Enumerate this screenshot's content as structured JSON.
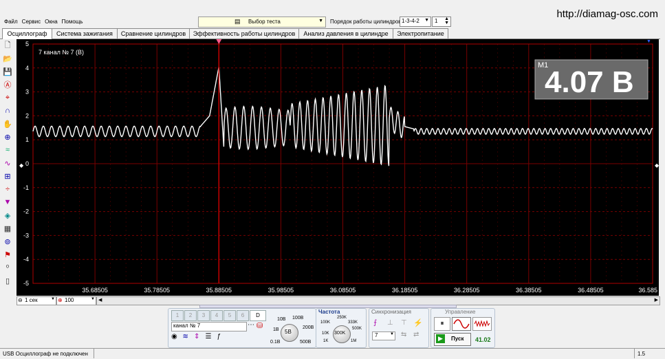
{
  "menu": [
    "Файл",
    "Сервис",
    "Окна",
    "Помощь"
  ],
  "site_url": "http://diamag-osc.com",
  "test_select": {
    "label": "Выбор теста"
  },
  "cylinder_order": {
    "label": "Порядок работы цилиндров",
    "value": "1-3-4-2",
    "stepper": "1"
  },
  "tabs": [
    {
      "label": "Осциллограф",
      "active": true
    },
    {
      "label": "Система зажигания",
      "active": false
    },
    {
      "label": "Сравнение цилиндров",
      "active": false
    },
    {
      "label": "Эффективность работы цилиндров",
      "active": false
    },
    {
      "label": "Анализ давления в цилиндре",
      "active": false
    },
    {
      "label": "Электропитание",
      "active": false
    }
  ],
  "toolbar_icons": [
    "new-file-icon",
    "open-folder-icon",
    "save-icon",
    "auto-icon",
    "cursor-icon",
    "headphones-icon",
    "hand-icon",
    "zoom-icon",
    "waves-icon",
    "wave-sync-icon",
    "measure-icon",
    "center-line-icon",
    "filter-icon",
    "layers-icon",
    "grid-icon",
    "reference-icon",
    "flag-icon",
    "zero-icon",
    "note-icon"
  ],
  "scope": {
    "channel_label": "7  канал № 7 (В)",
    "marker_label": "M1",
    "marker_value": "4.07 В",
    "waveform_color": "#ffffff",
    "grid_color": "#7a0000",
    "cursor_color": "#d00000"
  },
  "chart_data": {
    "type": "line",
    "y_ticks": [
      "5",
      "4",
      "3",
      "2",
      "1",
      "0",
      "-1",
      "-2",
      "-3",
      "-4",
      "-5"
    ],
    "x_ticks": [
      "35.68505",
      "35.78505",
      "35.88505",
      "35.98505",
      "36.08505",
      "36.18505",
      "36.28505",
      "36.38505",
      "36.48505",
      "36.585"
    ],
    "ylim": [
      -5,
      5
    ],
    "xlim": [
      35.585,
      36.585
    ],
    "cursor_x": 35.885,
    "marker_y": 4.07
  },
  "bottom_controls": {
    "time_scale": "1 сек",
    "count": "100"
  },
  "channel_panel": {
    "channel_buttons": [
      "1",
      "2",
      "3",
      "4",
      "5",
      "6"
    ],
    "d_button": "D",
    "channel_name": "канал № 7",
    "range_labels": [
      "10B",
      "100B",
      "1B",
      "200B",
      "0.1B",
      "500B"
    ],
    "range_value": "5B"
  },
  "frequency_panel": {
    "title": "Частота",
    "labels": [
      "250K",
      "100K",
      "333K",
      "10K",
      "500K",
      "1K",
      "1M"
    ],
    "value": "300K"
  },
  "sync_panel": {
    "title": "Синхронизация",
    "value": "7"
  },
  "control_panel": {
    "title": "Управление",
    "start_label": "Пуск",
    "fps": "41.02"
  },
  "status": {
    "left": "USB Осциллограф не подключен",
    "right": "1.5"
  }
}
